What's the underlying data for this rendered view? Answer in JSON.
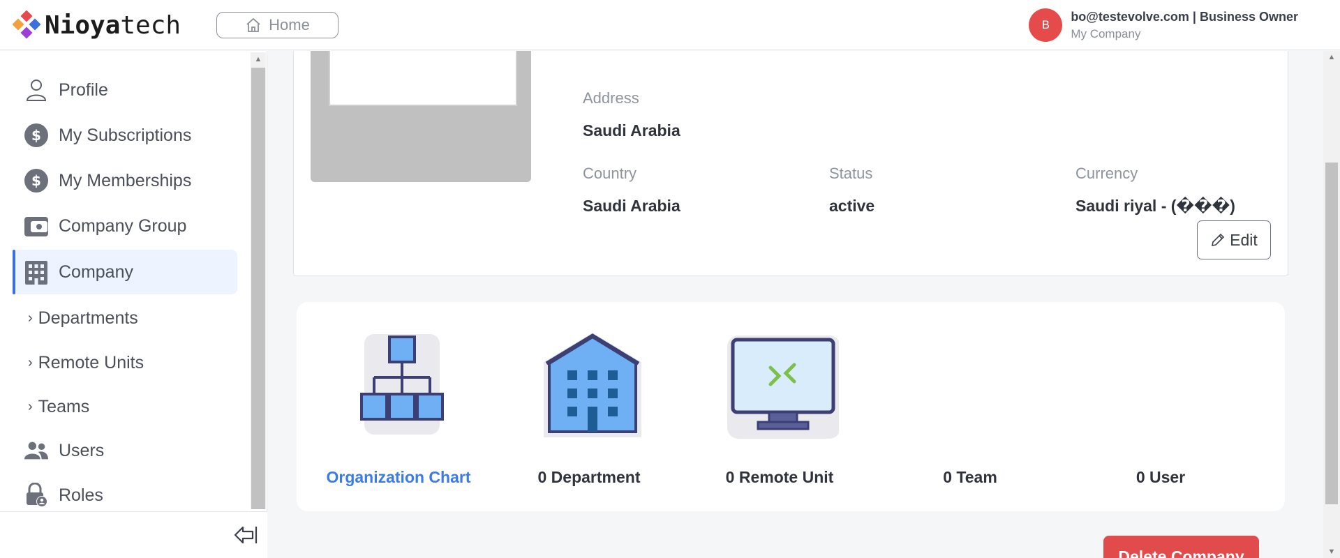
{
  "header": {
    "logo_bold": "Nioya",
    "logo_light": "tech",
    "home_label": "Home",
    "user_initial": "B",
    "user_email_role": "bo@testevolve.com | Business Owner",
    "user_company": "My Company"
  },
  "sidebar": {
    "items": [
      {
        "label": "Profile",
        "icon": "person-icon"
      },
      {
        "label": "My Subscriptions",
        "icon": "dollar-icon"
      },
      {
        "label": "My Memberships",
        "icon": "dollar-icon"
      },
      {
        "label": "Company Group",
        "icon": "wallet-icon"
      },
      {
        "label": "Company",
        "icon": "building-icon",
        "active": true
      }
    ],
    "sub_items": [
      {
        "label": "Departments"
      },
      {
        "label": "Remote Units"
      },
      {
        "label": "Teams"
      }
    ],
    "items_bottom": [
      {
        "label": "Users",
        "icon": "users-icon"
      },
      {
        "label": "Roles",
        "icon": "lock-user-icon"
      }
    ]
  },
  "company_info": {
    "address_label": "Address",
    "address_value": "Saudi Arabia",
    "country_label": "Country",
    "country_value": "Saudi Arabia",
    "status_label": "Status",
    "status_value": "active",
    "currency_label": "Currency",
    "currency_value": "Saudi riyal - (���)",
    "edit_label": "Edit"
  },
  "stats": [
    {
      "label": "Organization Chart",
      "icon": "org-chart-icon"
    },
    {
      "label": "0 Department",
      "icon": "building-icon"
    },
    {
      "label": "0 Remote Unit",
      "icon": "remote-desktop-icon"
    },
    {
      "label": "0 Team",
      "icon": ""
    },
    {
      "label": "0 User",
      "icon": ""
    }
  ],
  "actions": {
    "delete_label": "Delete Company"
  },
  "colors": {
    "accent": "#3b6fe0",
    "danger": "#e24b4b",
    "link": "#3b7be8"
  }
}
